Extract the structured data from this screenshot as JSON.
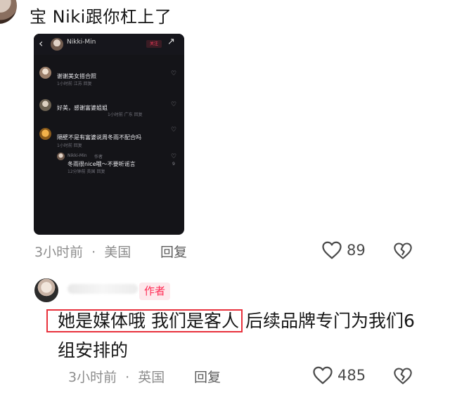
{
  "top_comment": {
    "text_line": "宝 Niki跟你杠上了",
    "meta": {
      "time": "3小时前",
      "separator": "·",
      "location": "美国",
      "reply": "回复"
    },
    "likes": "89"
  },
  "embedded_screenshot": {
    "header": {
      "username": "Nikki-Min",
      "follow_label": "关注"
    },
    "comments": [
      {
        "name": "",
        "text": "谢谢美女搭合照",
        "meta": "1小时前 江苏 回复"
      },
      {
        "name": "",
        "text": "好美，感谢富婆姐姐",
        "meta": "1小时前 广东 回复"
      },
      {
        "name": "",
        "text": "隔壁不是有富婆说周冬雨不配合吗",
        "meta": "1小时前 回复"
      }
    ],
    "reply": {
      "name": "Nikki-Min",
      "author_tag": "作者",
      "text": "冬雨很nice哦～不要听谣言",
      "meta": "12分钟前 英国 回复",
      "likes": "9"
    }
  },
  "author_comment": {
    "author_badge": "作者",
    "text_highlighted": "她是媒体哦 我们是客人",
    "text_rest": "后续品牌专门为我们6组安排的",
    "meta": {
      "time": "3小时前",
      "separator": "·",
      "location": "英国",
      "reply": "回复"
    },
    "likes": "485"
  },
  "icons": [
    "heart-outline-icon",
    "broken-heart-icon",
    "back-arrow-icon",
    "share-icon"
  ]
}
